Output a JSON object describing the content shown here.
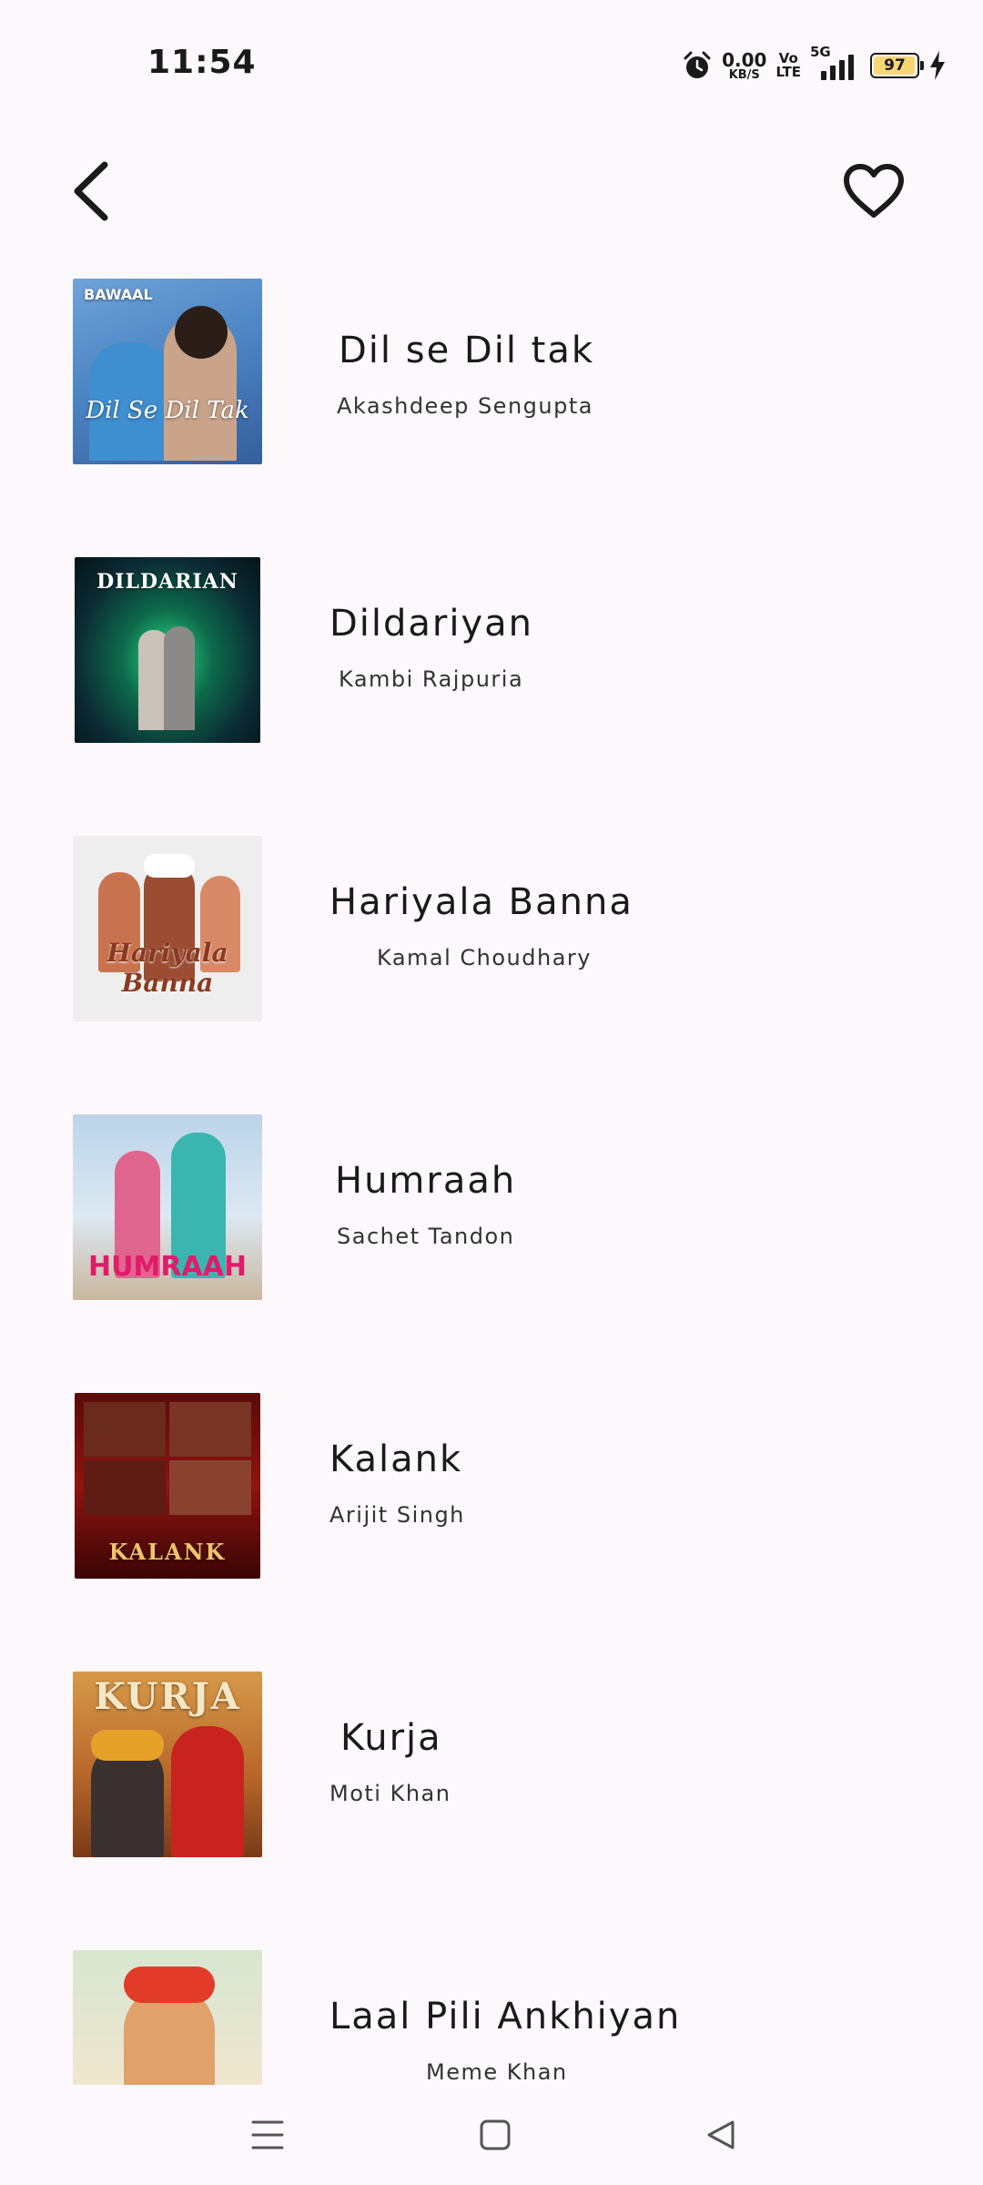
{
  "status": {
    "time": "11:54",
    "net_speed": "0.00",
    "net_unit": "KB/S",
    "volte_top": "Vo",
    "volte_bottom": "LTE",
    "network": "5G",
    "battery": "97",
    "battery_color": "#f7d774",
    "icons": [
      "alarm-icon",
      "signal-icon",
      "battery-icon",
      "charging-bolt-icon"
    ]
  },
  "header": {
    "back_icon": "chevron-left-icon",
    "favorite_icon": "heart-outline-icon"
  },
  "songs": [
    {
      "title": "Dil se Dil tak",
      "artist": "Akashdeep Sengupta",
      "cover_text": "BAWAAL",
      "cover_sub": "Dil Se Dil Tak"
    },
    {
      "title": "Dildariyan",
      "artist": "Kambi Rajpuria",
      "cover_text": "DILDARIAN"
    },
    {
      "title": "Hariyala Banna",
      "artist": "Kamal Choudhary",
      "cover_text": "Hariyala Banna"
    },
    {
      "title": "Humraah",
      "artist": "Sachet Tandon",
      "cover_text": "HUMRAAH"
    },
    {
      "title": "Kalank",
      "artist": "Arijit Singh",
      "cover_text": "KALANK"
    },
    {
      "title": "Kurja",
      "artist": "Moti Khan",
      "cover_text": "KURJA"
    },
    {
      "title": "Laal Pili Ankhiyan",
      "artist": "Meme Khan",
      "cover_text": ""
    }
  ],
  "navbar": {
    "icons": [
      "recent-apps-icon",
      "home-icon",
      "back-triangle-icon"
    ]
  }
}
